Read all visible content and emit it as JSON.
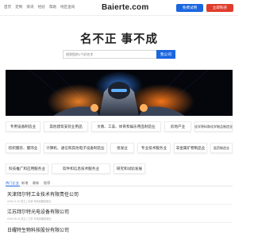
{
  "topbar": {
    "nav": [
      "首页",
      "定制",
      "资讯",
      "经验",
      "帮助",
      "地区查询"
    ],
    "logo": "Baierte.com",
    "free_btn": "免费试用",
    "buy_btn": "立即购买"
  },
  "hero": {
    "title": "名不正 事不成",
    "search_placeholder": "找到您的1个好名字",
    "search_btn": "我公司"
  },
  "categories": [
    "专用设备制造业",
    "其他建筑安装业用品",
    "文教、工美、体育和娱乐用品制造业",
    "房地产业",
    "化学原料和化学制品制造业",
    "纺织服装、服饰业",
    "计算机、通信和其他电子设备制造业",
    "批发业",
    "专业技术服务业",
    "非金属矿物制品业",
    "医药制造业",
    "科技推广和应用服务业",
    "软件和信息技术服务业",
    "研究和试验发展"
  ],
  "news": {
    "tabs": [
      "热门企业",
      "新增",
      "最新",
      "推荐"
    ],
    "items": [
      {
        "title": "天津拜尔特工业技术有限责任公司",
        "meta": "2018-11-15 成立  |  天津 专用设备制造业"
      },
      {
        "title": "江苏拜尔特光电设备有限公司",
        "meta": "2016-08-23 成立  |  江苏 专用设备制造业"
      },
      {
        "title": "日耀特生物科技股份有限公司",
        "meta": ""
      }
    ]
  },
  "colors": {
    "primary": "#1a66e0",
    "danger": "#e03c2b"
  }
}
